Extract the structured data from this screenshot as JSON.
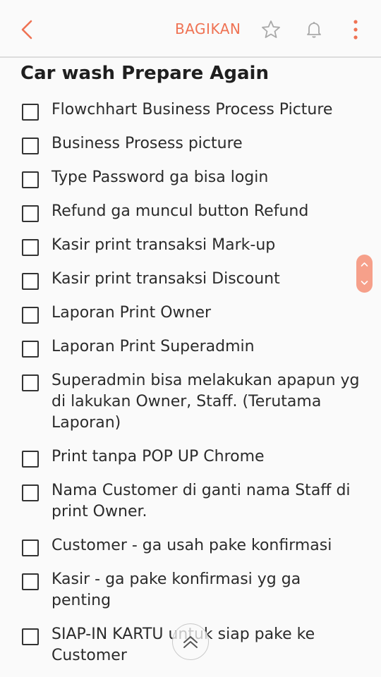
{
  "header": {
    "share_label": "BAGIKAN",
    "back_icon": "chevron-left-icon",
    "favorite_icon": "star-icon",
    "reminder_icon": "bell-icon",
    "more_icon": "more-vertical-icon",
    "accent_color": "#ef7253"
  },
  "note": {
    "title": "Car wash Prepare Again",
    "items": [
      {
        "text": "Flowchhart Business Process Picture",
        "checked": false
      },
      {
        "text": "Business Prosess picture",
        "checked": false
      },
      {
        "text": "Type Password ga bisa login",
        "checked": false
      },
      {
        "text": "Refund ga muncul button Refund",
        "checked": false
      },
      {
        "text": "Kasir print transaksi Mark-up",
        "checked": false
      },
      {
        "text": "Kasir print transaksi Discount",
        "checked": false
      },
      {
        "text": "Laporan Print Owner",
        "checked": false
      },
      {
        "text": "Laporan Print Superadmin",
        "checked": false
      },
      {
        "text": "Superadmin bisa melakukan apapun yg di lakukan Owner, Staff. (Terutama Laporan)",
        "checked": false
      },
      {
        "text": "Print tanpa POP UP Chrome",
        "checked": false
      },
      {
        "text": "Nama Customer di ganti nama Staff di print Owner.",
        "checked": false
      },
      {
        "text": "Customer - ga usah pake konfirmasi",
        "checked": false
      },
      {
        "text": "Kasir - ga pake konfirmasi yg ga penting",
        "checked": false
      },
      {
        "text": "SIAP-IN KARTU untuk siap pake ke Customer",
        "checked": false
      }
    ]
  },
  "controls": {
    "scroll_handle_icon": "scroll-up-down-icon",
    "scroll_top_icon": "chevron-up-icon",
    "scroll_handle_color": "#f6a08a"
  }
}
